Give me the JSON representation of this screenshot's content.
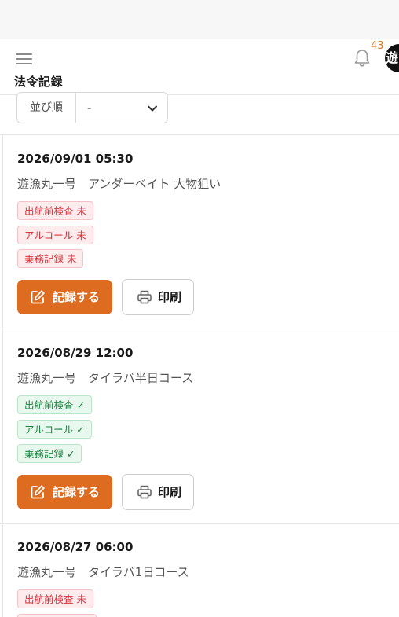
{
  "header": {
    "title": "法令記録",
    "notification_count": "43",
    "avatar_text": "遊"
  },
  "sort": {
    "label": "並び順",
    "value": "-"
  },
  "records": [
    {
      "date": "2026/09/01 05:30",
      "subtitle": "遊漁丸一号　アンダーベイト 大物狙い",
      "badges": [
        {
          "text": "出航前検査 未",
          "status": "incomplete"
        },
        {
          "text": "アルコール 未",
          "status": "incomplete"
        },
        {
          "text": "乗務記録 未",
          "status": "incomplete"
        }
      ],
      "record_label": "記録する",
      "print_label": "印刷"
    },
    {
      "date": "2026/08/29 12:00",
      "subtitle": "遊漁丸一号　タイラバ半日コース",
      "badges": [
        {
          "text": "出航前検査 ✓",
          "status": "complete"
        },
        {
          "text": "アルコール ✓",
          "status": "complete"
        },
        {
          "text": "乗務記録 ✓",
          "status": "complete"
        }
      ],
      "record_label": "記録する",
      "print_label": "印刷"
    },
    {
      "date": "2026/08/27 06:00",
      "subtitle": "遊漁丸一号　タイラバ1日コース",
      "badges": [
        {
          "text": "出航前検査 未",
          "status": "incomplete"
        }
      ]
    }
  ],
  "colors": {
    "accent": "#dd6b20",
    "notification": "#e07a16",
    "badge_incomplete": "#d6333b",
    "badge_complete": "#19853f"
  }
}
